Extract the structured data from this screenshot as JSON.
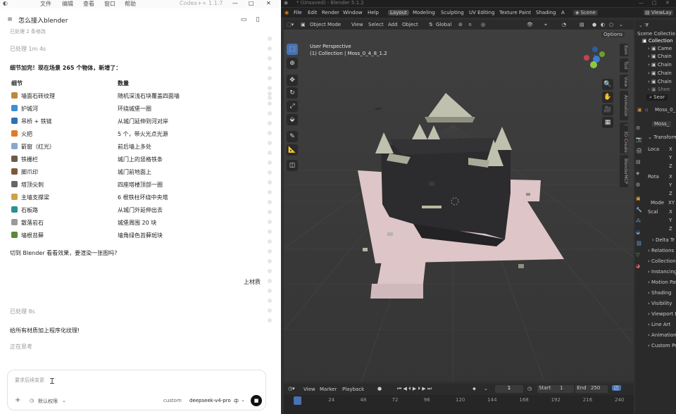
{
  "chat": {
    "menu": [
      "文件",
      "编辑",
      "查看",
      "窗口",
      "帮助"
    ],
    "app_title": "Codex++ 1.1.7",
    "thread_title": "怎么接入blender",
    "faded_top": "已处理 2 条修改",
    "processed_1": "已处理 1m 4s",
    "summary": "细节加完！现在场景 265 个物体，新增了：",
    "table": {
      "header_detail": "细节",
      "header_count": "数量",
      "rows": [
        {
          "detail": "墙面石砖纹理",
          "count": "随机深浅石块覆盖四面墙",
          "color": "#c0883a"
        },
        {
          "detail": "护城河",
          "count": "环绕城堡一圈",
          "color": "#3d8fd1"
        },
        {
          "detail": "吊桥 + 铁链",
          "count": "从城门延伸到河对岸",
          "color": "#2f6fb3"
        },
        {
          "detail": "火把",
          "count": "5 个，带火光点光源",
          "color": "#e0792a"
        },
        {
          "detail": "箭窗（红光）",
          "count": "前后墙上多处",
          "color": "#8aa8c8"
        },
        {
          "detail": "铁栅栏",
          "count": "城门上的竖格铁条",
          "color": "#6d5a4a"
        },
        {
          "detail": "脚爪印",
          "count": "城门前地面上",
          "color": "#7b5a3c"
        },
        {
          "detail": "塔顶尖刺",
          "count": "四座塔楼顶部一圈",
          "color": "#666666"
        },
        {
          "detail": "主墙支撑梁",
          "count": "6 根铁柱环绕中央塔",
          "color": "#d0a044"
        },
        {
          "detail": "石板路",
          "count": "从城门外延伸出去",
          "color": "#2f8f8f"
        },
        {
          "detail": "散落岩石",
          "count": "城堡周围 20 块",
          "color": "#9a9a9a"
        },
        {
          "detail": "墙根苔藓",
          "count": "墙角绿色苔藓斑块",
          "color": "#5a8a3a"
        }
      ]
    },
    "question": "切到 Blender 看看效果，要渲染一张图吗?",
    "user_msg_1": "上材质",
    "processed_2": "已处理 8s",
    "reply_2": "给所有材质加上程序化纹理!",
    "thinking": "正在思考",
    "input_placeholder": "要求后续变更",
    "access_label": "默认权限",
    "custom_label": "custom",
    "model_label": "deepseek-v4-pro",
    "model_level": "中"
  },
  "blender": {
    "title_bar": "* (Unsaved) - Blender 5.1.2",
    "menus": [
      "File",
      "Edit",
      "Render",
      "Window",
      "Help"
    ],
    "workspaces": [
      "Layout",
      "Modeling",
      "Sculpting",
      "UV Editing",
      "Texture Paint",
      "Shading",
      "A"
    ],
    "active_workspace": "Layout",
    "scene_label": "Scene",
    "viewlayer_label": "ViewLay",
    "viewport": {
      "mode": "Object Mode",
      "menus": [
        "View",
        "Select",
        "Add",
        "Object"
      ],
      "orientation": "Global",
      "options": "Options",
      "overlay_title": "User Perspective",
      "overlay_sub": "(1) Collection | Moss_0_4_8_1.2",
      "side_tabs": [
        "Item",
        "Tool",
        "View",
        "Animation",
        "Edit",
        "3D-Print",
        "Create",
        "BlenderMCP"
      ]
    },
    "outliner": {
      "items": [
        "Scene Collectio",
        "Collection",
        "Came",
        "Chain",
        "Chain",
        "Chain",
        "Chain",
        "Shee"
      ],
      "search": "Sear"
    },
    "properties": {
      "object_name": "Moss_0_",
      "object_name2": "Moss_",
      "panels": [
        "Transform",
        "Delta Tr",
        "Relations",
        "Collections",
        "Instancing",
        "Motion Pat",
        "Shading",
        "Visibility",
        "Viewport D",
        "Line Art",
        "Animation",
        "Custom Pro"
      ],
      "location_label": "Loca",
      "rotation_label": "Rota",
      "mode_label": "Mode",
      "mode_value": "XY",
      "scale_label": "Scal",
      "axes": [
        "X",
        "Y",
        "Z",
        "X",
        "Y",
        "Z",
        "X",
        "Y",
        "Z"
      ]
    },
    "timeline": {
      "menus": [
        "View",
        "Marker",
        "Playback"
      ],
      "current_frame": "1",
      "start_label": "Start",
      "start_value": "1",
      "end_label": "End",
      "end_value": "250",
      "ruler": [
        "1",
        "24",
        "48",
        "72",
        "96",
        "120",
        "144",
        "168",
        "192",
        "216",
        "240"
      ]
    }
  }
}
